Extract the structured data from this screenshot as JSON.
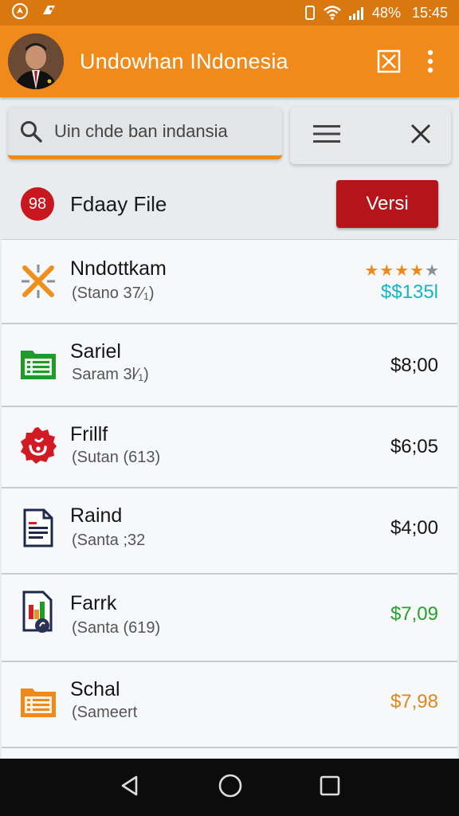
{
  "status_bar": {
    "battery": "48%",
    "time": "15:45"
  },
  "app_bar": {
    "title": "Undowhan INdonesia"
  },
  "search": {
    "text": "Uin chde ban indansia"
  },
  "file_header": {
    "count": "98",
    "title": "Fdaay File",
    "button_label": "Versi"
  },
  "items": [
    {
      "name": "Nndottkam",
      "sub": "(Stano 37⁄₁)",
      "price": "$$135l",
      "price_color": "#13b6c4",
      "rating": "★★★★",
      "rating_empty": "★"
    },
    {
      "name": "Sariel",
      "sub": "Saram 3l⁄₁)",
      "price": "$8;00",
      "price_color": "#151515"
    },
    {
      "name": "Frillf",
      "sub": "(Sutan (613)",
      "price": "$6;05",
      "price_color": "#151515"
    },
    {
      "name": "Raind",
      "sub": "(Santa ;32",
      "price": "$4;00",
      "price_color": "#151515"
    },
    {
      "name": "Farrk",
      "sub": "(Santa (619)",
      "price": "$7,09",
      "price_color": "#25a12c"
    },
    {
      "name": "Schal",
      "sub": "(Sameert",
      "price": "$7,98",
      "price_color": "#e0861a"
    }
  ],
  "colors": {
    "accent": "#f08a1a",
    "status_bar": "#d9780f",
    "badge": "#c8171e",
    "button": "#b5141a"
  }
}
